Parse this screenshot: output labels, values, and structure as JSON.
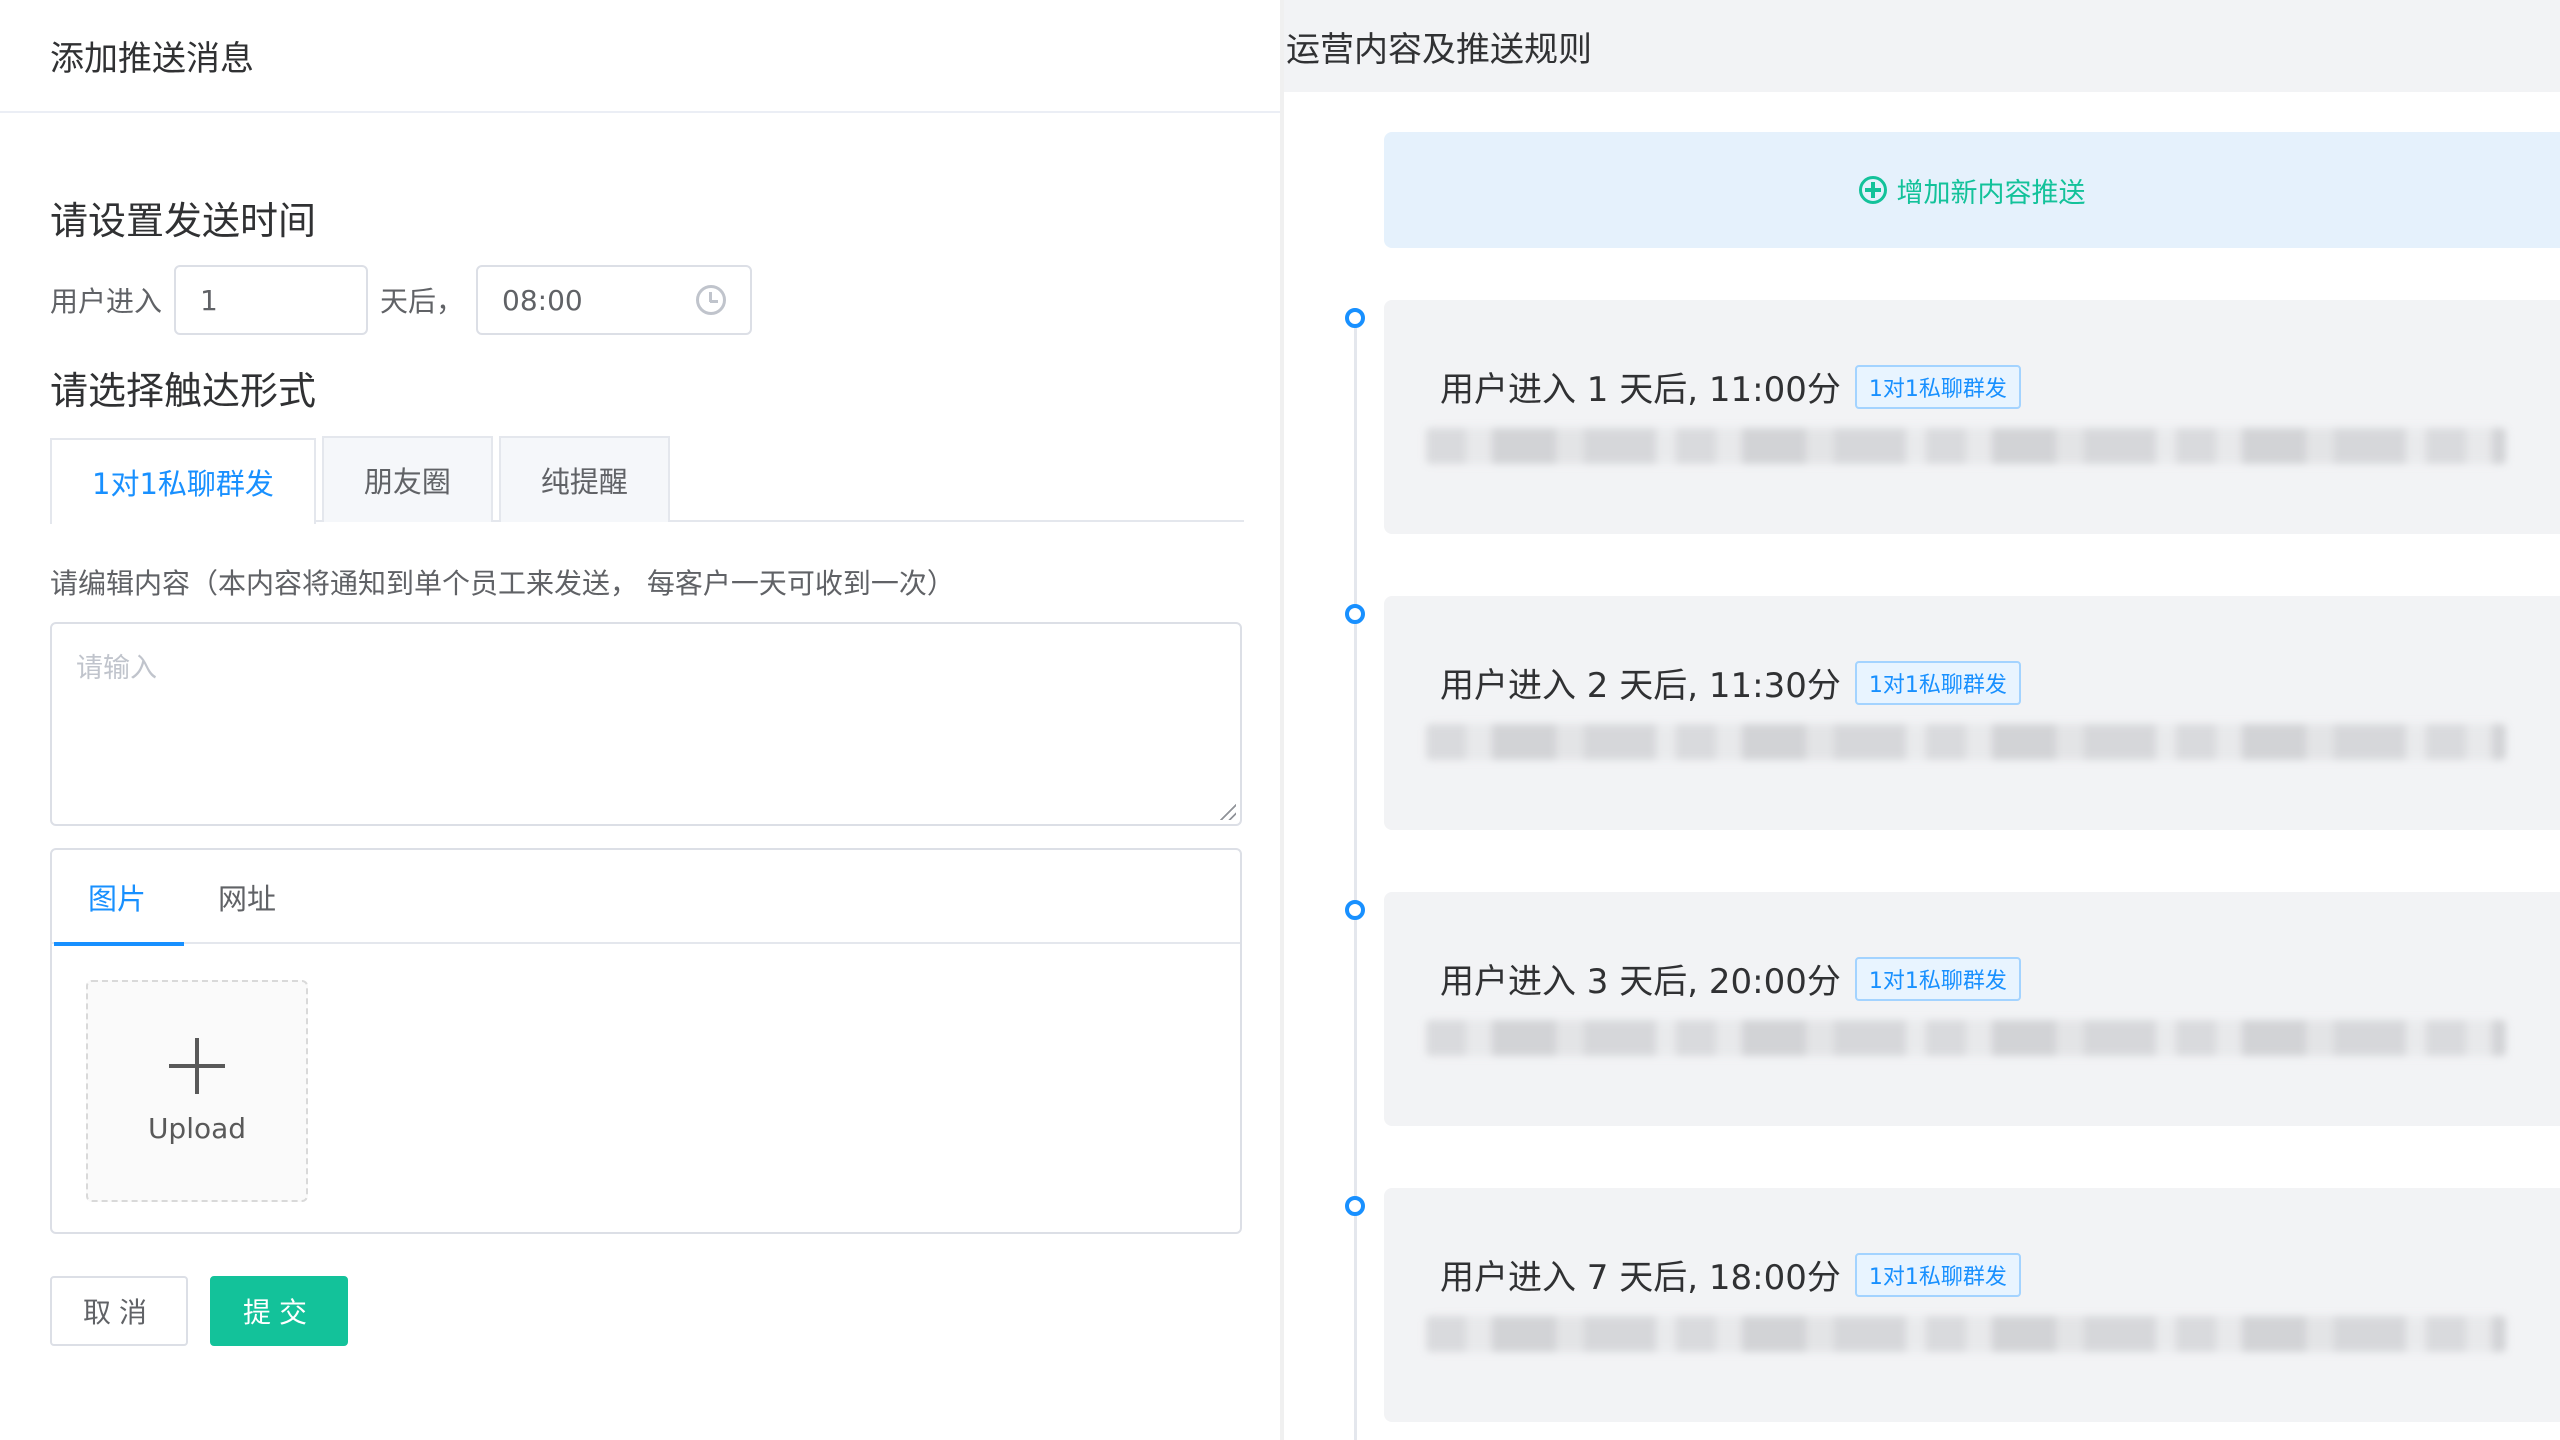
{
  "left": {
    "header_title": "添加推送消息",
    "send_time_title": "请设置发送时间",
    "user_enter_label": "用户进入",
    "days_value": "1",
    "days_after_label": "天后，",
    "time_value": "08:00",
    "touch_form_title": "请选择触达形式",
    "touch_tabs": [
      "1对1私聊群发",
      "朋友圈",
      "纯提醒"
    ],
    "content_hint": "请编辑内容（本内容将通知到单个员工来发送， 每客户一天可收到一次）",
    "content_placeholder": "请输入",
    "media_tabs": [
      "图片",
      "网址"
    ],
    "upload_label": "Upload",
    "cancel_label": "取消",
    "submit_label": "提交"
  },
  "right": {
    "header_title": "运营内容及推送规则",
    "add_label": "增加新内容推送",
    "rules": [
      {
        "title": "用户进入 1 天后, 11:00分",
        "tag": "1对1私聊群发"
      },
      {
        "title": "用户进入 2 天后, 11:30分",
        "tag": "1对1私聊群发"
      },
      {
        "title": "用户进入 3 天后, 20:00分",
        "tag": "1对1私聊群发"
      },
      {
        "title": "用户进入 7 天后, 18:00分",
        "tag": "1对1私聊群发"
      }
    ]
  },
  "colors": {
    "primary_blue": "#1890ff",
    "submit_green": "#13c29a",
    "add_box_bg": "#e5f1fc"
  }
}
